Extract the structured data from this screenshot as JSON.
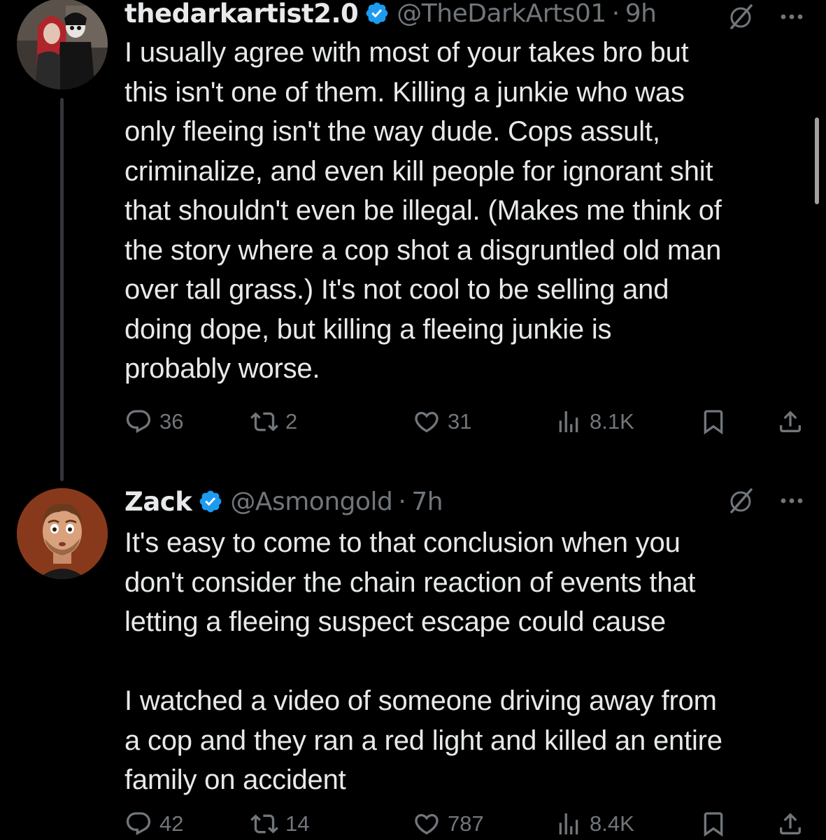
{
  "tweets": [
    {
      "display_name": "thedarkartist2.0",
      "handle": "@TheDarkArts01",
      "separator": "·",
      "time": "9h",
      "text": "I usually agree with most of your takes bro but\nthis isn't one of them. Killing a junkie who was\nonly fleeing isn't the way dude. Cops assult,\ncriminalize, and even kill people for ignorant shit\nthat shouldn't even be illegal. (Makes me think of\nthe story where a cop shot a disgruntled old man\nover tall grass.) It's not cool to be selling and\ndoing dope, but killing a fleeing junkie is\nprobably worse.",
      "replies": "36",
      "reposts": "2",
      "likes": "31",
      "views": "8.1K",
      "verified": true
    },
    {
      "display_name": "Zack",
      "handle": "@Asmongold",
      "separator": "·",
      "time": "7h",
      "text": "It's easy to come to that conclusion when you\ndon't consider the chain reaction of events that\nletting a fleeing suspect escape could cause\n\nI watched a video of someone driving away from\na cop and they ran a red light and killed an entire\nfamily on accident",
      "replies": "42",
      "reposts": "14",
      "likes": "787",
      "views": "8.4K",
      "verified": true
    }
  ],
  "icons": {
    "reply": "reply-icon",
    "repost": "repost-icon",
    "like": "heart-icon",
    "views": "views-icon",
    "bookmark": "bookmark-icon",
    "share": "share-icon",
    "grok": "grok-icon",
    "more": "more-icon",
    "verified": "verified-badge-icon"
  },
  "colors": {
    "background": "#000000",
    "text_primary": "#e7e9ea",
    "text_secondary": "#71767b",
    "verified_blue": "#1d9bf0",
    "thread_line": "#333639"
  }
}
